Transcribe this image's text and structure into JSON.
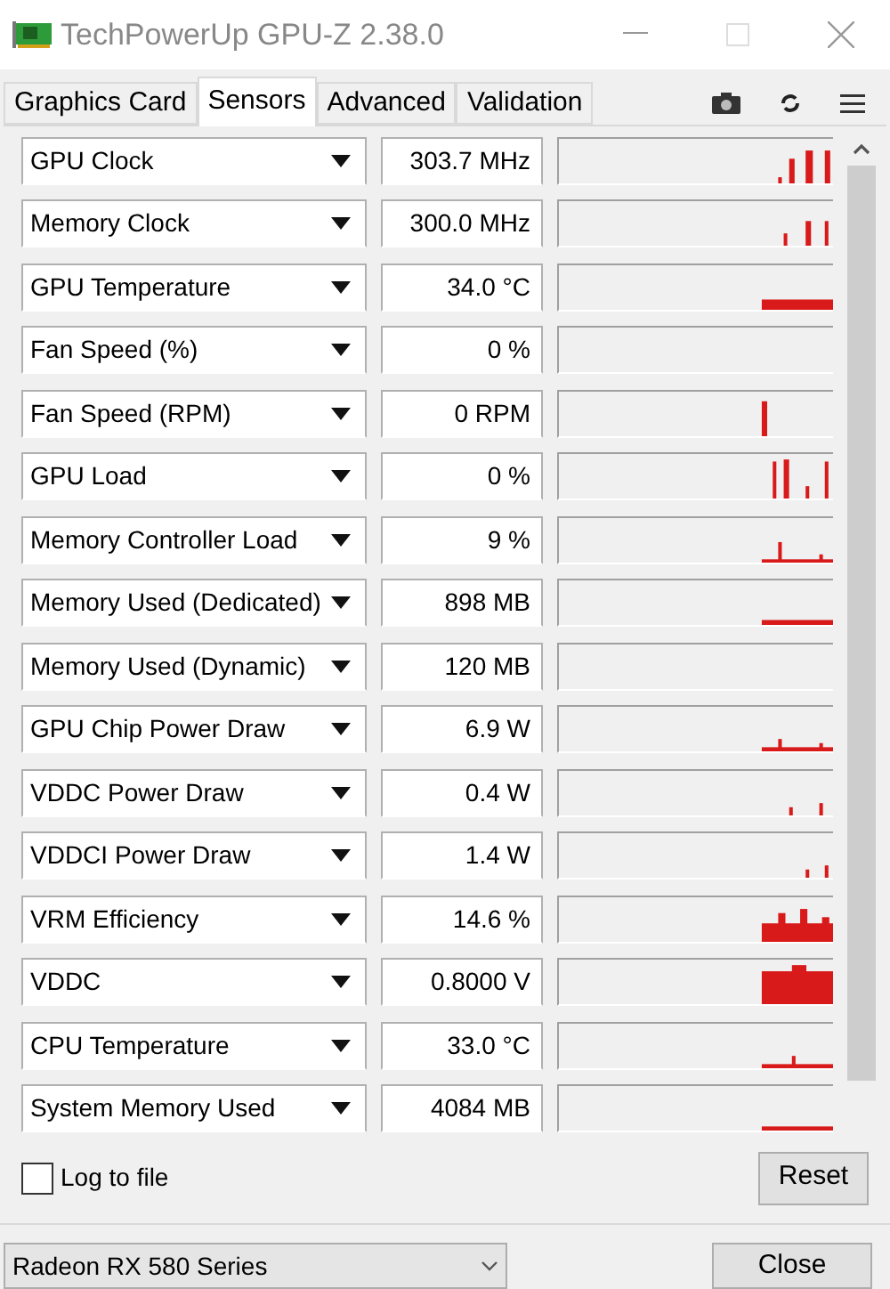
{
  "window": {
    "title": "TechPowerUp GPU-Z 2.38.0"
  },
  "tabs": [
    {
      "label": "Graphics Card",
      "selected": false
    },
    {
      "label": "Sensors",
      "selected": true
    },
    {
      "label": "Advanced",
      "selected": false
    },
    {
      "label": "Validation",
      "selected": false
    }
  ],
  "sensors": [
    {
      "name": "GPU Clock",
      "value": "303.7 MHz"
    },
    {
      "name": "Memory Clock",
      "value": "300.0 MHz"
    },
    {
      "name": "GPU Temperature",
      "value": "34.0 °C"
    },
    {
      "name": "Fan Speed (%)",
      "value": "0 %"
    },
    {
      "name": "Fan Speed (RPM)",
      "value": "0 RPM"
    },
    {
      "name": "GPU Load",
      "value": "0 %"
    },
    {
      "name": "Memory Controller Load",
      "value": "9 %"
    },
    {
      "name": "Memory Used (Dedicated)",
      "value": "898 MB"
    },
    {
      "name": "Memory Used (Dynamic)",
      "value": "120 MB"
    },
    {
      "name": "GPU Chip Power Draw",
      "value": "6.9 W"
    },
    {
      "name": "VDDC Power Draw",
      "value": "0.4 W"
    },
    {
      "name": "VDDCI Power Draw",
      "value": "1.4 W"
    },
    {
      "name": "VRM Efficiency",
      "value": "14.6 %"
    },
    {
      "name": "VDDC",
      "value": "0.8000 V"
    },
    {
      "name": "CPU Temperature",
      "value": "33.0 °C"
    },
    {
      "name": "System Memory Used",
      "value": "4084 MB"
    }
  ],
  "log_to_file": {
    "label": "Log to file",
    "checked": false
  },
  "reset_button": "Reset",
  "device_select": {
    "value": "Radeon RX 580 Series"
  },
  "close_button": "Close"
}
